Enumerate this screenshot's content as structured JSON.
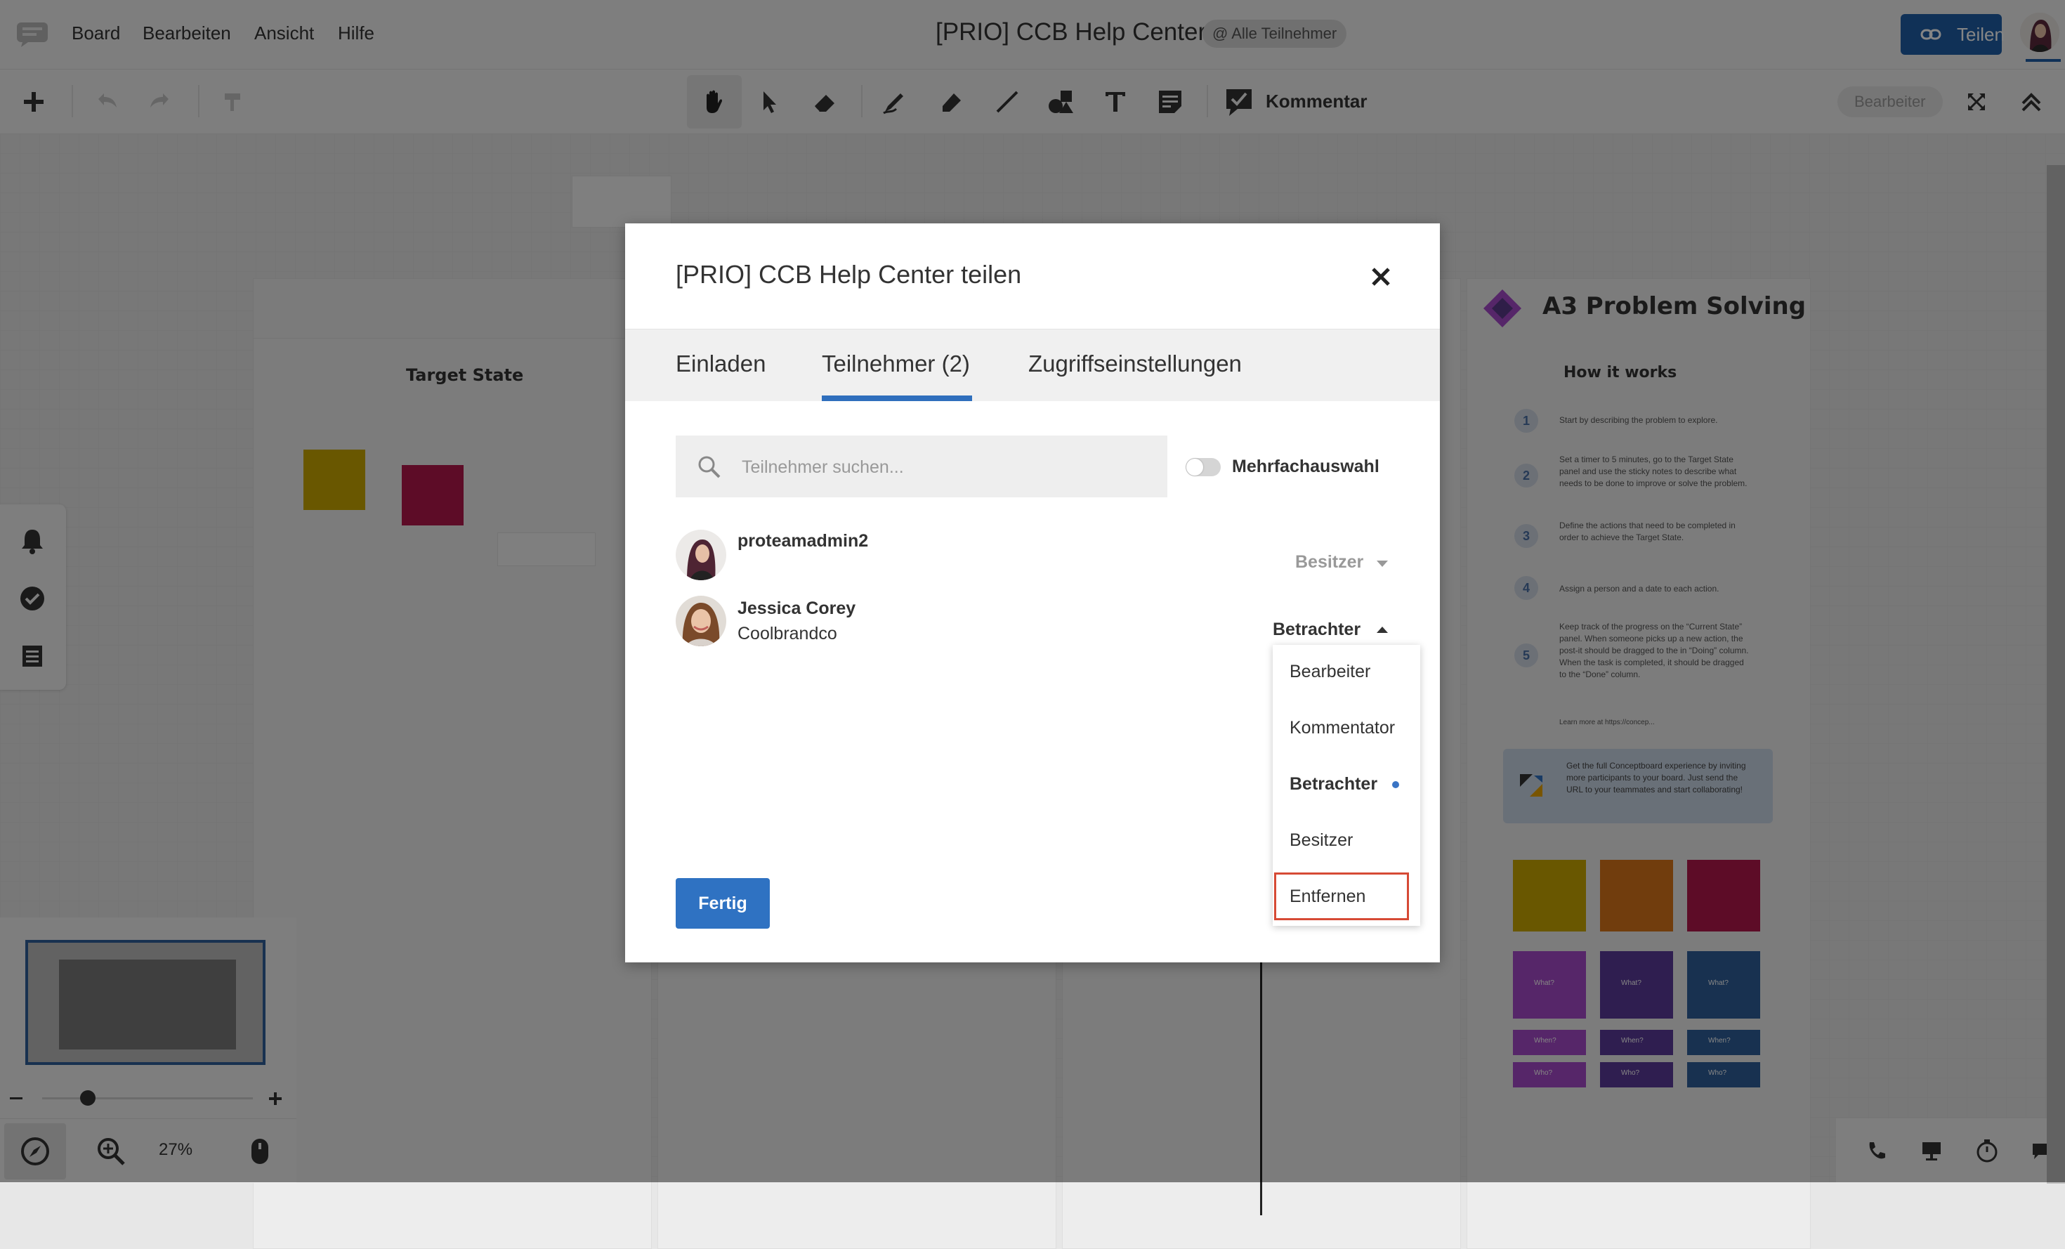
{
  "menubar": {
    "items": [
      "Board",
      "Bearbeiten",
      "Ansicht",
      "Hilfe"
    ],
    "board_title": "[PRIO] CCB Help Center",
    "participants_badge": "@ Alle Teilnehmer",
    "share_label": "Teilen"
  },
  "toolbar": {
    "comment_label": "Kommentar",
    "role_badge": "Bearbeiter",
    "tools": [
      "plus-icon",
      "undo-icon",
      "redo-icon",
      "format-painter-icon",
      "hand-icon",
      "pointer-icon",
      "eraser-icon",
      "pen-icon",
      "highlighter-icon",
      "line-icon",
      "shapes-icon",
      "text-icon",
      "sticky-note-icon",
      "comment-icon"
    ]
  },
  "canvas": {
    "target_state_title": "Target State",
    "a3_title": "A3 Problem Solving",
    "how_it_works_title": "How it works",
    "steps": [
      {
        "n": "1",
        "text": "Start by describing the problem to explore."
      },
      {
        "n": "2",
        "text": "Set a timer to 5 minutes, go to the Target State panel and use the sticky notes to describe what needs to be done to improve or solve the problem."
      },
      {
        "n": "3",
        "text": "Define the actions that need to be completed in order to achieve the Target State."
      },
      {
        "n": "4",
        "text": "Assign a person and a date to each action."
      },
      {
        "n": "5",
        "text": "Keep track of the progress on the “Current State” panel. When someone picks up a new action, the post-it should be dragged to the in “Doing” column. When the task is completed, it should be dragged to the “Done” column."
      }
    ],
    "learn_more": "Learn more at https://concep...",
    "promo_text": "Get the full Conceptboard experience by inviting more participants to your board. Just send the URL to your teammates and start collaborating!",
    "sticky_labels": [
      "What?",
      "When?",
      "Who?"
    ],
    "zoom_level": "27%"
  },
  "dialog": {
    "title": "[PRIO] CCB Help Center teilen",
    "tabs": [
      "Einladen",
      "Teilnehmer (2)",
      "Zugriffseinstellungen"
    ],
    "search_placeholder": "Teilnehmer suchen...",
    "multi_select_label": "Mehrfachauswahl",
    "participants": [
      {
        "name": "proteamadmin2",
        "sub": "",
        "role": "Besitzer"
      },
      {
        "name": "Jessica Corey",
        "sub": "Coolbrandco",
        "role": "Betrachter"
      }
    ],
    "done_label": "Fertig",
    "role_menu": [
      "Bearbeiter",
      "Kommentator",
      "Betrachter",
      "Besitzer",
      "Entfernen"
    ],
    "selected_role": "Betrachter"
  },
  "colors": {
    "accent": "#2f72c2",
    "share_button": "#1f5fa8",
    "remove_highlight": "#d64a35"
  }
}
